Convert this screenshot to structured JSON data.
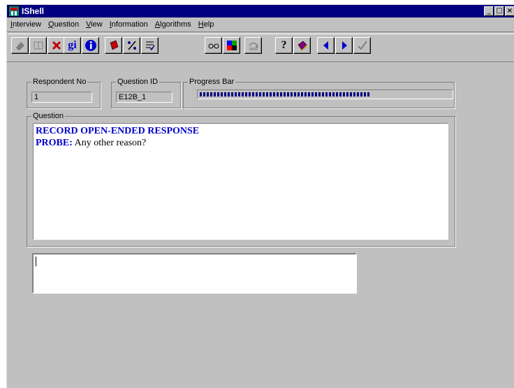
{
  "window": {
    "title": "IShell"
  },
  "menu": [
    "Interview",
    "Question",
    "View",
    "Information",
    "Algorithms",
    "Help"
  ],
  "menu_mnemonics": [
    "I",
    "Q",
    "V",
    "I",
    "A",
    "H"
  ],
  "toolbar": {
    "gi_label": "gi",
    "info_label": "i",
    "help_label": "?"
  },
  "fields": {
    "respondent_label": "Respondent No",
    "respondent_value": "1",
    "question_id_label": "Question ID",
    "question_id_value": "E12B_1",
    "progress_label": "Progress Bar",
    "progress_fraction": 0.68
  },
  "question": {
    "label": "Question",
    "line1": "RECORD OPEN-ENDED RESPONSE",
    "probe_prefix": "PROBE:",
    "probe_text": " Any other reason?"
  },
  "answer": {
    "value": ""
  },
  "colors": {
    "titlebar": "#000080",
    "question_text": "#0000cc",
    "progress": "#000080"
  }
}
